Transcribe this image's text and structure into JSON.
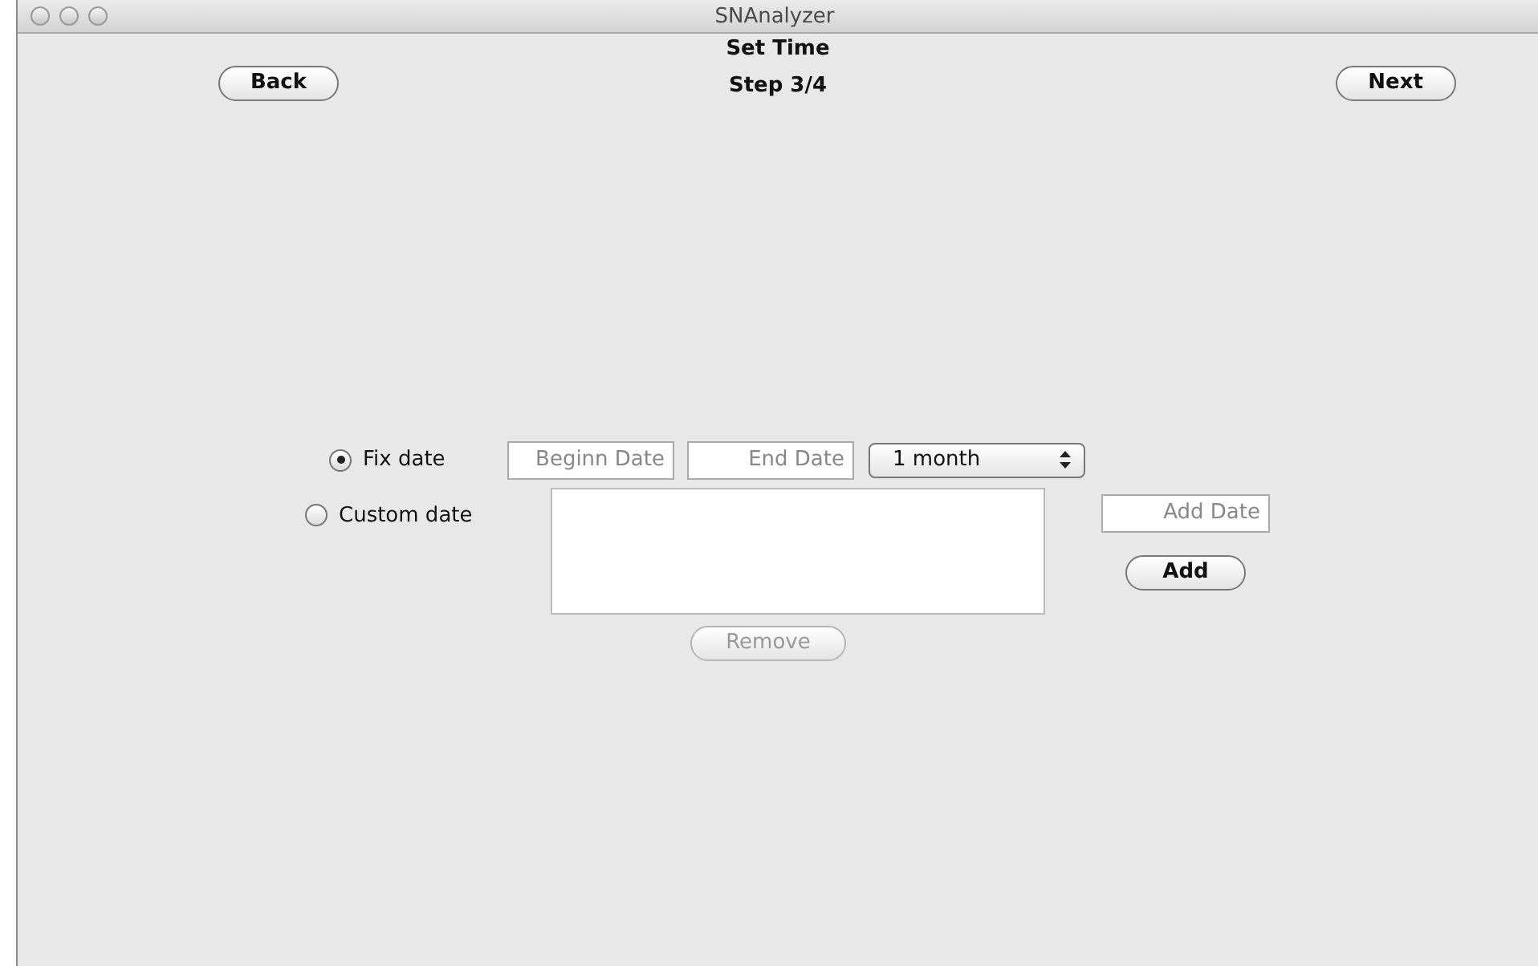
{
  "window": {
    "title": "SNAnalyzer"
  },
  "header": {
    "title": "Set Time",
    "step": "Step 3/4"
  },
  "nav": {
    "back": "Back",
    "next": "Next"
  },
  "modes": [
    {
      "label": "Fix date",
      "selected": true
    },
    {
      "label": "Custom date",
      "selected": false
    }
  ],
  "fix_date": {
    "begin": {
      "placeholder": "Beginn Date"
    },
    "end": {
      "placeholder": "End Date"
    },
    "period": "1 month"
  },
  "custom_date": {
    "add_field": {
      "placeholder": "Add Date"
    },
    "add_button": {
      "label": "Add",
      "disabled": false
    },
    "remove_button": {
      "label": "Remove",
      "disabled": true
    }
  }
}
